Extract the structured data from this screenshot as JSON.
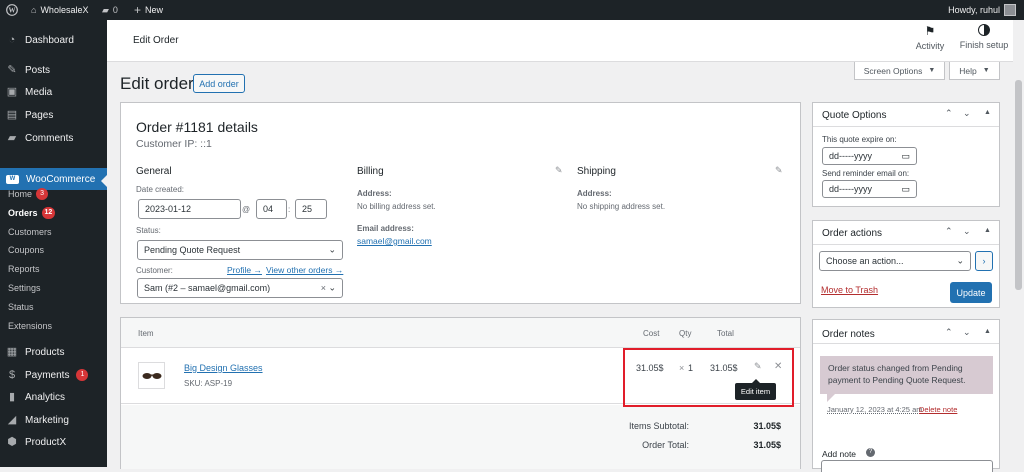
{
  "adminbar": {
    "site": "WholesaleX",
    "comments": "0",
    "new": "New",
    "howdy": "Howdy, ruhul"
  },
  "sidebar": {
    "top": [
      {
        "label": "Dashboard"
      },
      {
        "label": "Posts"
      },
      {
        "label": "Media"
      },
      {
        "label": "Pages"
      },
      {
        "label": "Comments"
      }
    ],
    "woo": "WooCommerce",
    "sub": [
      {
        "label": "Home",
        "badge": "3"
      },
      {
        "label": "Orders",
        "badge": "12"
      },
      {
        "label": "Customers"
      },
      {
        "label": "Coupons"
      },
      {
        "label": "Reports"
      },
      {
        "label": "Settings"
      },
      {
        "label": "Status"
      },
      {
        "label": "Extensions"
      }
    ],
    "bottom": [
      {
        "label": "Products"
      },
      {
        "label": "Payments",
        "badge": "1"
      },
      {
        "label": "Analytics"
      },
      {
        "label": "Marketing"
      },
      {
        "label": "ProductX"
      }
    ]
  },
  "header": {
    "title": "Edit Order",
    "activity": "Activity",
    "finish_setup": "Finish setup",
    "screen_options": "Screen Options",
    "help": "Help"
  },
  "page": {
    "heading": "Edit order",
    "add_order": "Add order"
  },
  "order": {
    "title": "Order #1181 details",
    "customer_ip": "Customer IP: ::1",
    "general": {
      "heading": "General",
      "date_label": "Date created:",
      "date": "2023-01-12",
      "at": "@",
      "hour": "04",
      "minute": "25",
      "status_label": "Status:",
      "status": "Pending Quote Request",
      "customer_label": "Customer:",
      "profile_link": "Profile →",
      "other_orders_link": "View other orders →",
      "customer": "Sam (#2 – samael@gmail.com)"
    },
    "billing": {
      "heading": "Billing",
      "address_label": "Address:",
      "address": "No billing address set.",
      "email_label": "Email address:",
      "email": "samael@gmail.com"
    },
    "shipping": {
      "heading": "Shipping",
      "address_label": "Address:",
      "address": "No shipping address set."
    }
  },
  "items": {
    "headers": {
      "item": "Item",
      "cost": "Cost",
      "qty": "Qty",
      "total": "Total"
    },
    "rows": [
      {
        "name": "Big Design Glasses",
        "sku": "SKU: ASP-19",
        "cost": "31.05$",
        "qty_x": "×",
        "qty": "1",
        "total": "31.05$"
      }
    ],
    "tooltip": "Edit item",
    "subtotal_label": "Items Subtotal:",
    "subtotal": "31.05$",
    "order_total_label": "Order Total:",
    "order_total": "31.05$"
  },
  "quote_options": {
    "title": "Quote Options",
    "expire_label": "This quote expire on:",
    "expire_placeholder": "dd-----yyyy",
    "reminder_label": "Send reminder email on:",
    "reminder_placeholder": "dd-----yyyy"
  },
  "order_actions": {
    "title": "Order actions",
    "select": "Choose an action...",
    "trash": "Move to Trash",
    "update": "Update"
  },
  "order_notes": {
    "title": "Order notes",
    "note": "Order status changed from Pending payment to Pending Quote Request.",
    "note_date": "January 12, 2023 at 4:25 am",
    "delete": "Delete note",
    "add_note": "Add note"
  },
  "colors": {
    "accent": "#2271b1",
    "highlight_box": "#e11d2a",
    "note_bg": "#d7cad2",
    "admin_dark": "#1d2327"
  }
}
